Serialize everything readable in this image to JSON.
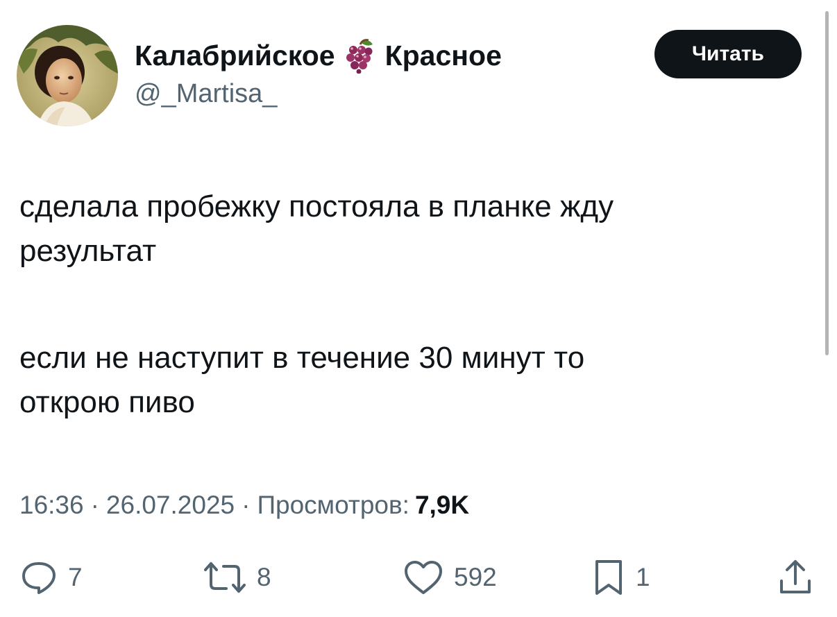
{
  "author": {
    "name_part1": "Калабрийское",
    "emoji_icon": "grapes-icon",
    "name_part2": "Красное",
    "handle": "@_Martisa_"
  },
  "follow_button": {
    "label": "Читать"
  },
  "tweet": {
    "paragraph1": "сделала пробежку постояла в планке жду\nрезультат",
    "paragraph2": "если не наступит в течение 30 минут то\nоткрою пиво"
  },
  "meta": {
    "time": "16:36",
    "separator": "·",
    "date": "26.07.2025",
    "views_label": "Просмотров:",
    "views_count": "7,9K"
  },
  "actions": {
    "replies": {
      "icon": "reply-icon",
      "count": "7"
    },
    "reposts": {
      "icon": "repost-icon",
      "count": "8"
    },
    "likes": {
      "icon": "heart-icon",
      "count": "592"
    },
    "bookmarks": {
      "icon": "bookmark-icon",
      "count": "1"
    },
    "share": {
      "icon": "share-icon"
    }
  },
  "colors": {
    "text_primary": "#0f1419",
    "text_secondary": "#536471",
    "button_bg": "#0f1419",
    "button_text": "#ffffff",
    "grape": "#8e2a5a"
  }
}
